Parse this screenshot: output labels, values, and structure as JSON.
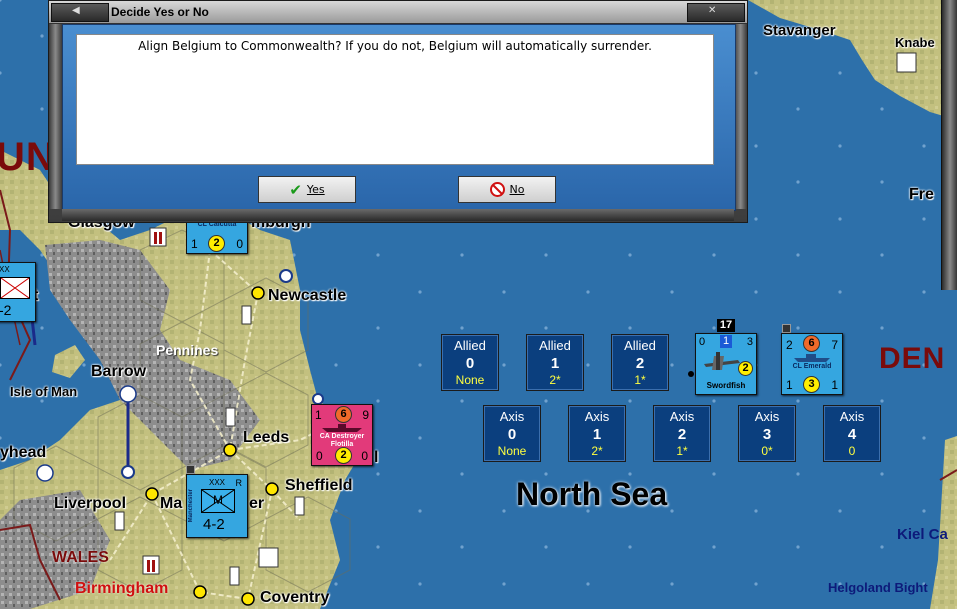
{
  "dialog": {
    "title": "Decide Yes or No",
    "message": "Align Belgium to Commonwealth?  If you do not, Belgium will automatically surrender.",
    "yes_label": "Yes",
    "no_label": "No"
  },
  "map": {
    "sea_label": "North Sea",
    "places": {
      "stavanger": "Stavanger",
      "knabe": "Knabe",
      "fre": "Fre",
      "den": "DEN",
      "un": "UN",
      "glasgow": "Glasgow",
      "edinburgh": "mburgh",
      "newcastle": "Newcastle",
      "pennines": "Pennines",
      "barrow": "Barrow",
      "isle_of_man": "Isle of Man",
      "leeds": "Leeds",
      "head": "yhead",
      "sheffield": "Sheffield",
      "liverpool": "Liverpool",
      "manchester": "Ma",
      "manchester_end": "er",
      "wales": "WALES",
      "birmingham": "Birmingham",
      "coventry": "Coventry",
      "kiel": "Kiel Ca",
      "helgoland": "Helgoland Bight",
      "t_frag": "t",
      "l_frag": "l"
    }
  },
  "track": {
    "allied": [
      {
        "side": "Allied",
        "num": "0",
        "sub": "None"
      },
      {
        "side": "Allied",
        "num": "1",
        "sub": "2*"
      },
      {
        "side": "Allied",
        "num": "2",
        "sub": "1*"
      }
    ],
    "axis": [
      {
        "side": "Axis",
        "num": "0",
        "sub": "None"
      },
      {
        "side": "Axis",
        "num": "1",
        "sub": "2*"
      },
      {
        "side": "Axis",
        "num": "2",
        "sub": "1*"
      },
      {
        "side": "Axis",
        "num": "3",
        "sub": "0*"
      },
      {
        "side": "Axis",
        "num": "4",
        "sub": "0"
      }
    ]
  },
  "counters": {
    "swordfish": {
      "stack": "17",
      "left": "0",
      "mid": "1",
      "right": "3",
      "circle": "2",
      "name": "Swordfish"
    },
    "emerald": {
      "left": "2",
      "top": "6",
      "right": "7",
      "bl": "1",
      "circle": "3",
      "br": "1",
      "name": "CL Emerald"
    },
    "destroyer": {
      "tl": "1",
      "top": "6",
      "tr": "9",
      "bl": "0",
      "circle": "2",
      "br": "0",
      "name": "CA Destroyer Flotilla"
    },
    "calcutta": {
      "name": "CL Calcutta",
      "bl": "1",
      "circle": "2",
      "br": "0"
    },
    "manchester_corps": {
      "size": "XXX",
      "tag": "R",
      "code": "M",
      "strength": "4-2",
      "side_name": "Manchester"
    },
    "west_unit": {
      "size": "XX",
      "strength": "-2"
    }
  },
  "colors": {
    "sea": "#2b6fa8",
    "land": "#b9b67a",
    "mountain": "#8c8c8c",
    "counter_blue": "#2ea0de",
    "counter_pink": "#e23a7a"
  }
}
